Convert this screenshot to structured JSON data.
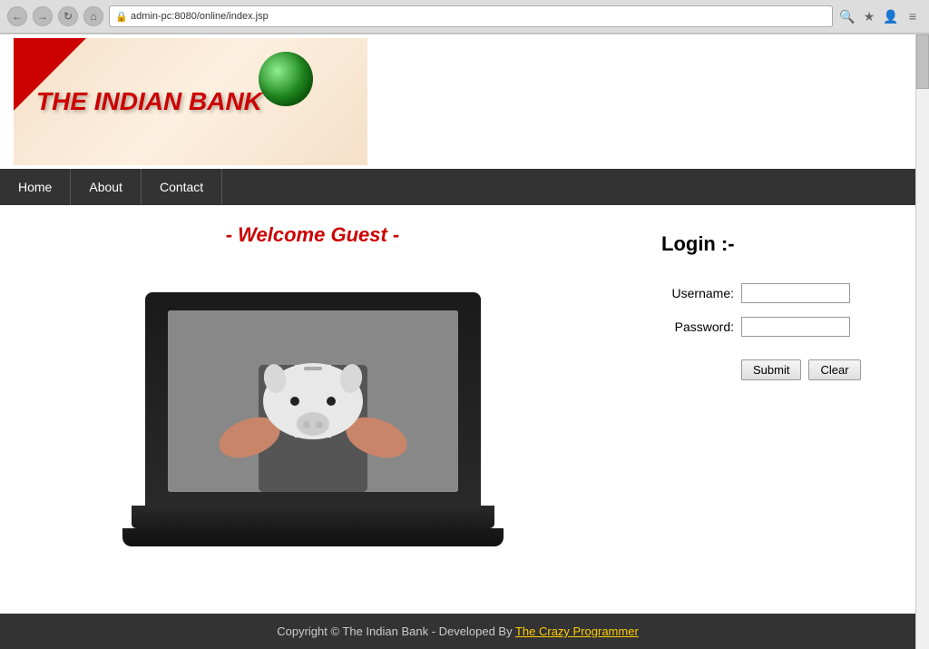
{
  "browser": {
    "address": "admin-pc:8080/online/index.jsp",
    "back_title": "Back",
    "forward_title": "Forward",
    "reload_title": "Reload",
    "home_title": "Home"
  },
  "header": {
    "bank_name": "THE INDIAN BANK"
  },
  "navbar": {
    "items": [
      {
        "id": "home",
        "label": "Home"
      },
      {
        "id": "about",
        "label": "About"
      },
      {
        "id": "contact",
        "label": "Contact"
      }
    ]
  },
  "main": {
    "welcome": "- Welcome Guest -",
    "login": {
      "title": "Login :-",
      "username_label": "Username:",
      "password_label": "Password:",
      "username_value": "",
      "password_value": "",
      "submit_label": "Submit",
      "clear_label": "Clear"
    }
  },
  "footer": {
    "text": "Copyright © The Indian Bank - Developed By ",
    "link_text": "The Crazy Programmer",
    "link_url": "#"
  }
}
